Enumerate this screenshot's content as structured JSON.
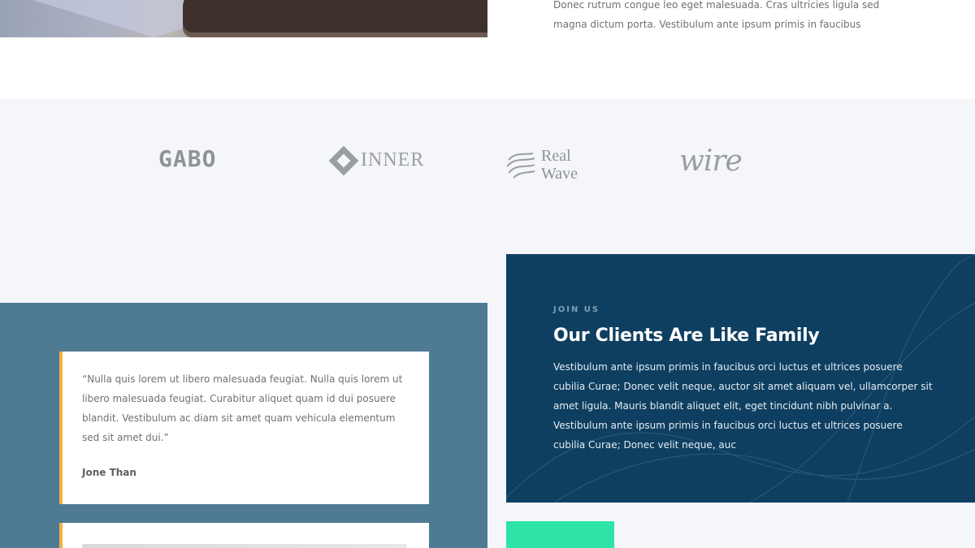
{
  "top": {
    "text": "Donec rutrum congue leo eget malesuada. Cras ultricies ligula sed magna dictum porta. Vestibulum ante ipsum primis in faucibus"
  },
  "logos": {
    "gabo": "GABO",
    "inner": "INNER",
    "realwave_line1": "Real",
    "realwave_line2": "Wave",
    "wire": "wire"
  },
  "testimonials": [
    {
      "quote": "“Nulla quis lorem ut libero malesuada feugiat. Nulla quis lorem ut libero malesuada feugiat. Curabitur aliquet quam id dui posuere blandit. Vestibulum ac diam sit amet quam vehicula elementum sed sit amet dui.”",
      "author": "Jone Than"
    }
  ],
  "join": {
    "eyebrow": "JOIN US",
    "title": "Our Clients Are Like Family",
    "body": "Vestibulum ante ipsum primis in faucibus orci luctus et ultrices posuere cubilia Curae; Donec velit neque, auctor sit amet aliquam vel, ullamcorper sit amet ligula. Mauris blandit aliquet elit, eget tincidunt nibh pulvinar a. Vestibulum ante ipsum primis in faucibus orci luctus et ultrices posuere cubilia Curae; Donec velit neque, auc"
  },
  "colors": {
    "accent_green": "#2ee3a6",
    "card_navy": "#0e3f61",
    "panel_blue": "#4f7a94",
    "quote_border": "#f0b33c",
    "band_bg": "#f5f6fa"
  },
  "icons": [
    "inner-diamond-icon",
    "realwave-waves-icon"
  ]
}
